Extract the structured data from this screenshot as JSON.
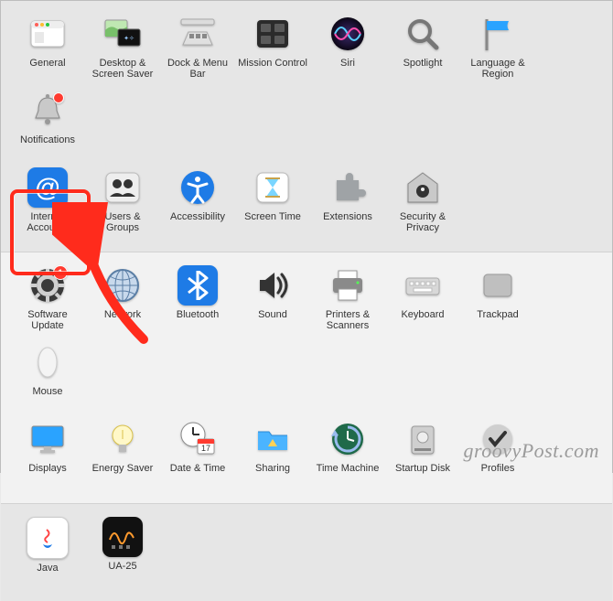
{
  "watermark": "groovyPost.com",
  "groups": [
    {
      "bg": "a",
      "rows": [
        [
          {
            "id": "general",
            "label": "General"
          },
          {
            "id": "desktop",
            "label": "Desktop & Screen Saver"
          },
          {
            "id": "dock",
            "label": "Dock & Menu Bar"
          },
          {
            "id": "mission",
            "label": "Mission Control"
          },
          {
            "id": "siri",
            "label": "Siri"
          },
          {
            "id": "spotlight",
            "label": "Spotlight"
          },
          {
            "id": "language",
            "label": "Language & Region"
          },
          {
            "id": "notifications",
            "label": "Notifications",
            "badge": "dot"
          }
        ],
        [
          {
            "id": "internet",
            "label": "Internet Accounts"
          },
          {
            "id": "users",
            "label": "Users & Groups"
          },
          {
            "id": "accessibility",
            "label": "Accessibility"
          },
          {
            "id": "screentime",
            "label": "Screen Time"
          },
          {
            "id": "extensions",
            "label": "Extensions"
          },
          {
            "id": "security",
            "label": "Security & Privacy"
          }
        ]
      ]
    },
    {
      "bg": "b",
      "rows": [
        [
          {
            "id": "softwareupdate",
            "label": "Software Update",
            "badge": "1",
            "highlight": true
          },
          {
            "id": "network",
            "label": "Network"
          },
          {
            "id": "bluetooth",
            "label": "Bluetooth"
          },
          {
            "id": "sound",
            "label": "Sound"
          },
          {
            "id": "printers",
            "label": "Printers & Scanners"
          },
          {
            "id": "keyboard",
            "label": "Keyboard"
          },
          {
            "id": "trackpad",
            "label": "Trackpad"
          },
          {
            "id": "mouse",
            "label": "Mouse"
          }
        ],
        [
          {
            "id": "displays",
            "label": "Displays"
          },
          {
            "id": "energy",
            "label": "Energy Saver"
          },
          {
            "id": "datetime",
            "label": "Date & Time"
          },
          {
            "id": "sharing",
            "label": "Sharing"
          },
          {
            "id": "timemachine",
            "label": "Time Machine"
          },
          {
            "id": "startup",
            "label": "Startup Disk"
          },
          {
            "id": "profiles",
            "label": "Profiles"
          }
        ]
      ]
    },
    {
      "bg": "a",
      "rows": [
        [
          {
            "id": "java",
            "label": "Java"
          },
          {
            "id": "ua25",
            "label": "UA-25"
          }
        ]
      ]
    }
  ]
}
